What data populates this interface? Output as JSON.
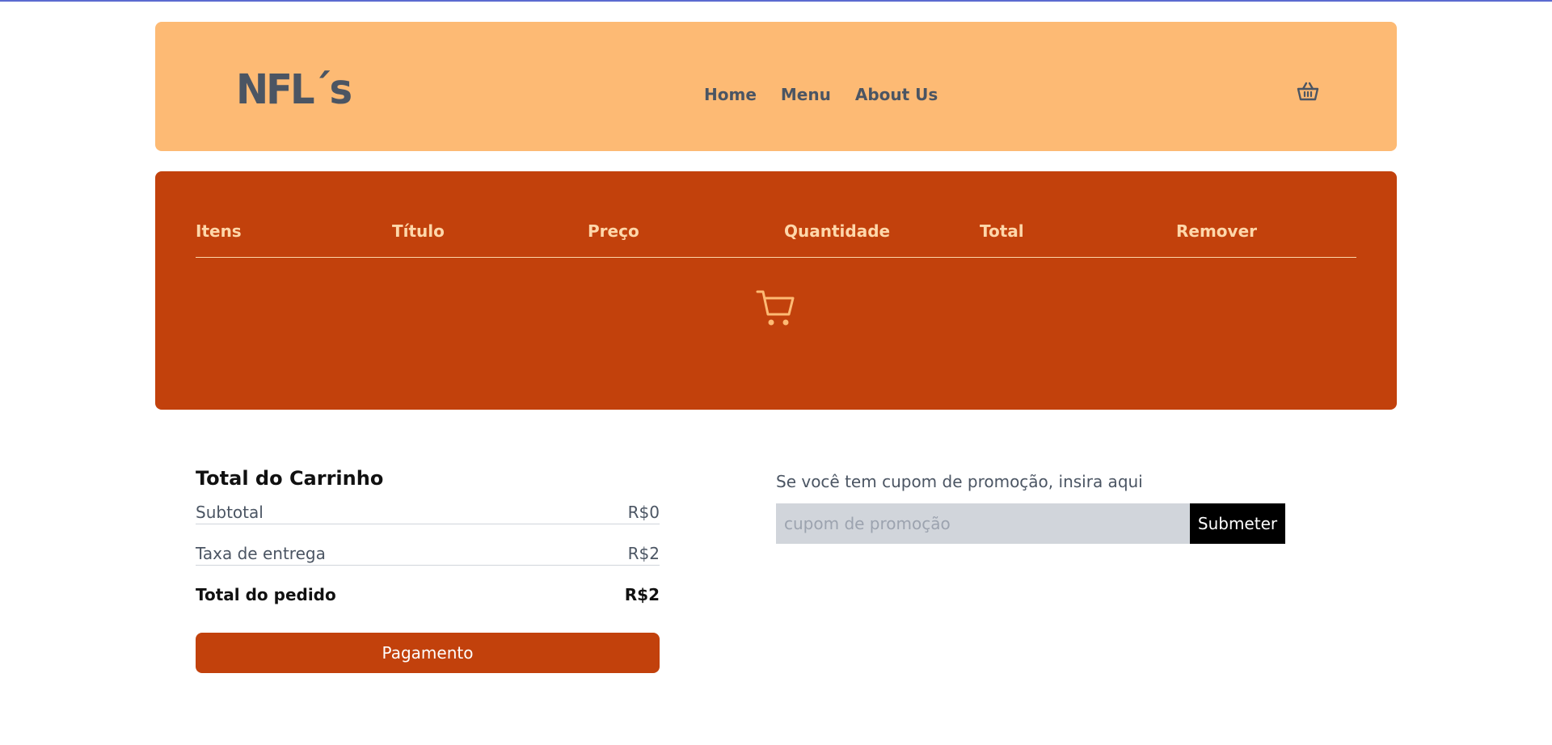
{
  "header": {
    "logo": "NFL´s",
    "nav": [
      "Home",
      "Menu",
      "About Us"
    ],
    "basket_icon": "basket-icon"
  },
  "cart": {
    "columns": [
      "Itens",
      "Título",
      "Preço",
      "Quantidade",
      "Total",
      "Remover"
    ],
    "empty_icon": "cart-icon"
  },
  "totals": {
    "title": "Total do Carrinho",
    "subtotal_label": "Subtotal",
    "subtotal_value": "R$0",
    "fee_label": "Taxa de entrega",
    "fee_value": "R$2",
    "total_label": "Total do pedido",
    "total_value": "R$2",
    "pay_label": "Pagamento"
  },
  "promo": {
    "text": "Se você tem cupom de promoção, insira aqui",
    "placeholder": "cupom de promoção",
    "submit_label": "Submeter"
  },
  "colors": {
    "header_bg": "#fdba74",
    "cart_bg": "#c2410c",
    "accent": "#c2410c"
  }
}
